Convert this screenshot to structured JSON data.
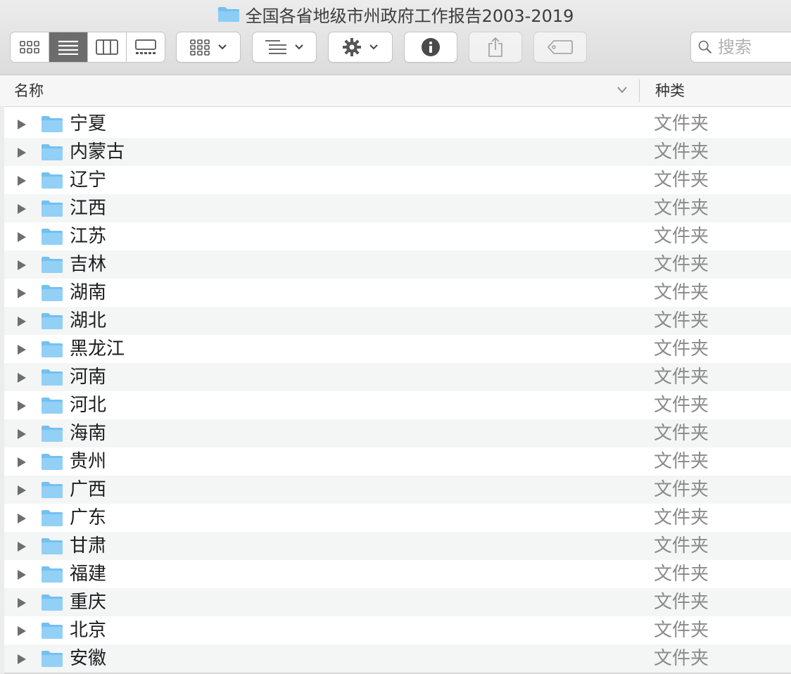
{
  "window": {
    "title": "全国各省地级市州政府工作报告2003-2019"
  },
  "toolbar": {
    "view_modes": [
      {
        "name": "icon-view",
        "icon": "grid-icon",
        "active": false
      },
      {
        "name": "list-view",
        "icon": "list-icon",
        "active": true
      },
      {
        "name": "column-view",
        "icon": "columns-icon",
        "active": false
      },
      {
        "name": "gallery-view",
        "icon": "gallery-icon",
        "active": false
      }
    ],
    "group_icon": "group-by-icon",
    "arrange_icon": "arrange-icon",
    "action_icon": "gear-icon",
    "info_icon": "info-icon",
    "share_icon": "share-icon",
    "tag_icon": "tag-icon",
    "search_placeholder": "搜索"
  },
  "columns": {
    "name": "名称",
    "kind": "种类"
  },
  "colors": {
    "folder": "#74c0f0",
    "active_segment": "#6c6c6c"
  },
  "rows": [
    {
      "name": "宁夏",
      "kind": "文件夹"
    },
    {
      "name": "内蒙古",
      "kind": "文件夹"
    },
    {
      "name": "辽宁",
      "kind": "文件夹"
    },
    {
      "name": "江西",
      "kind": "文件夹"
    },
    {
      "name": "江苏",
      "kind": "文件夹"
    },
    {
      "name": "吉林",
      "kind": "文件夹"
    },
    {
      "name": "湖南",
      "kind": "文件夹"
    },
    {
      "name": "湖北",
      "kind": "文件夹"
    },
    {
      "name": "黑龙江",
      "kind": "文件夹"
    },
    {
      "name": "河南",
      "kind": "文件夹"
    },
    {
      "name": "河北",
      "kind": "文件夹"
    },
    {
      "name": "海南",
      "kind": "文件夹"
    },
    {
      "name": "贵州",
      "kind": "文件夹"
    },
    {
      "name": "广西",
      "kind": "文件夹"
    },
    {
      "name": "广东",
      "kind": "文件夹"
    },
    {
      "name": "甘肃",
      "kind": "文件夹"
    },
    {
      "name": "福建",
      "kind": "文件夹"
    },
    {
      "name": "重庆",
      "kind": "文件夹"
    },
    {
      "name": "北京",
      "kind": "文件夹"
    },
    {
      "name": "安徽",
      "kind": "文件夹"
    }
  ]
}
